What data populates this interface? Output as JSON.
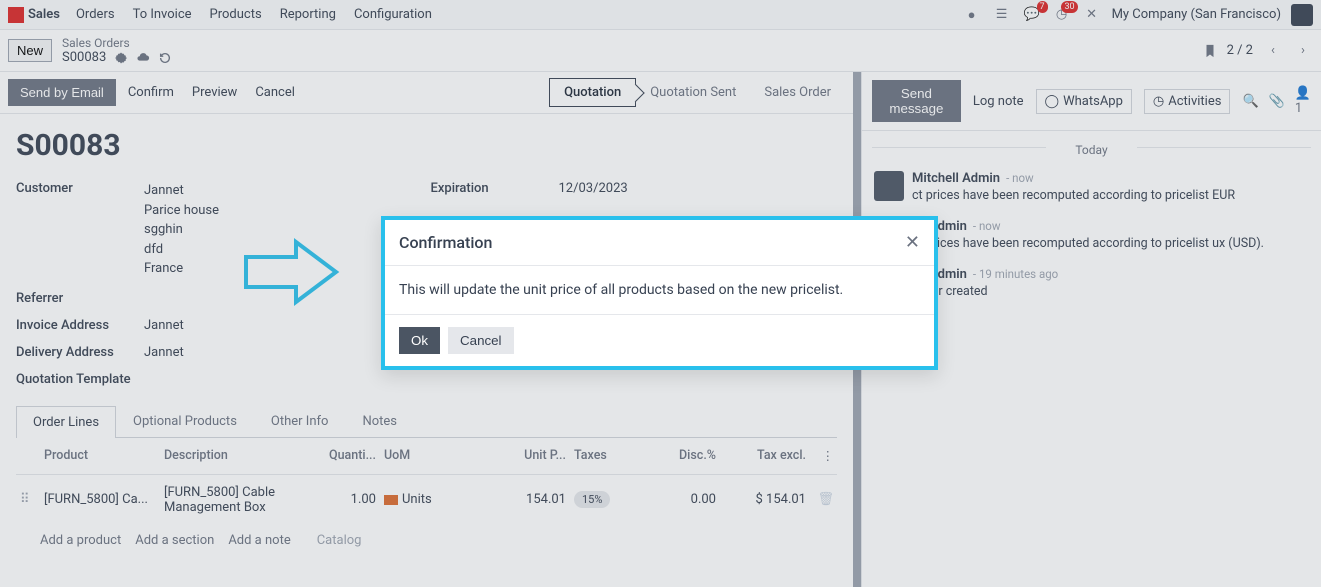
{
  "topnav": {
    "app": "Sales",
    "items": [
      "Orders",
      "To Invoice",
      "Products",
      "Reporting",
      "Configuration"
    ],
    "chat_badge": "7",
    "clock_badge": "30",
    "company": "My Company (San Francisco)"
  },
  "crumb": {
    "new_label": "New",
    "parent": "Sales Orders",
    "current": "S00083",
    "pager": "2 / 2"
  },
  "actions": {
    "send_email": "Send by Email",
    "confirm": "Confirm",
    "preview": "Preview",
    "cancel": "Cancel"
  },
  "statusbar": {
    "quotation": "Quotation",
    "sent": "Quotation Sent",
    "order": "Sales Order"
  },
  "order": {
    "id": "S00083",
    "labels": {
      "customer": "Customer",
      "referrer": "Referrer",
      "invoice_addr": "Invoice Address",
      "delivery_addr": "Delivery Address",
      "quote_tmpl": "Quotation Template",
      "expiration": "Expiration"
    },
    "customer_name": "Jannet",
    "customer_addr": [
      "Parice house",
      "sgghin",
      "dfd",
      "France"
    ],
    "invoice_addr": "Jannet",
    "delivery_addr": "Jannet",
    "expiration": "12/03/2023"
  },
  "tabs": {
    "order_lines": "Order Lines",
    "optional": "Optional Products",
    "other": "Other Info",
    "notes": "Notes"
  },
  "line_table": {
    "head": {
      "product": "Product",
      "description": "Description",
      "quantity": "Quanti...",
      "uom": "UoM",
      "unit_price": "Unit P...",
      "taxes": "Taxes",
      "disc": "Disc.%",
      "tax_excl": "Tax excl."
    },
    "row": {
      "product": "[FURN_5800] Ca...",
      "description": "[FURN_5800] Cable Management Box",
      "quantity": "1.00",
      "uom": "Units",
      "unit_price": "154.01",
      "tax": "15%",
      "disc": "0.00",
      "tax_excl": "$ 154.01"
    },
    "add": {
      "product": "Add a product",
      "section": "Add a section",
      "note": "Add a note",
      "catalog": "Catalog"
    }
  },
  "chatter": {
    "send": "Send message",
    "log": "Log note",
    "whatsapp": "WhatsApp",
    "activities": "Activities",
    "follower_count": "1",
    "today": "Today",
    "messages": [
      {
        "author": "Mitchell Admin",
        "time": "now",
        "text": "ct prices have been recomputed according to pricelist EUR"
      },
      {
        "author": "ell Admin",
        "time": "now",
        "text": "ct prices have been recomputed according to pricelist ux (USD)."
      },
      {
        "author": "ell Admin",
        "time": "19 minutes ago",
        "text": "Order created"
      }
    ]
  },
  "modal": {
    "title": "Confirmation",
    "body": "This will update the unit price of all products based on the new pricelist.",
    "ok": "Ok",
    "cancel": "Cancel"
  }
}
